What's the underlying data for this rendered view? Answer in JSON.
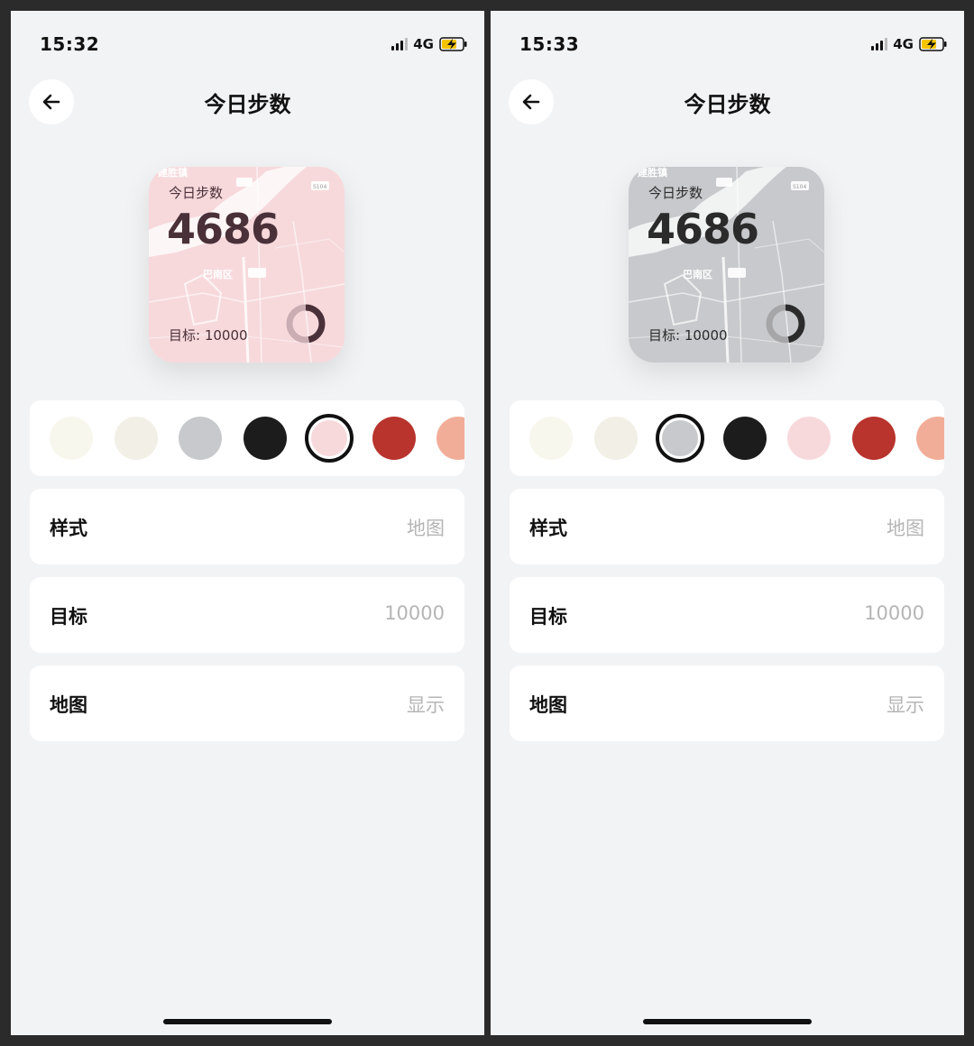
{
  "screens": [
    {
      "status": {
        "time": "15:32",
        "network": "4G"
      },
      "title": "今日步数",
      "widget": {
        "label": "今日步数",
        "steps": "4686",
        "goal_prefix": "目标: ",
        "goal_value": "10000",
        "progress": 0.4686,
        "background": "#f7d9dc",
        "text_color": "#4a3038",
        "ring_track": "#c9adb3",
        "ring_fill": "#4a3038"
      },
      "swatches": [
        {
          "color": "#f8f7ee",
          "selected": false
        },
        {
          "color": "#f2efe6",
          "selected": false
        },
        {
          "color": "#c8c9cc",
          "selected": false
        },
        {
          "color": "#1c1c1c",
          "selected": false
        },
        {
          "color": "#f7d9dc",
          "selected": true
        },
        {
          "color": "#b8342d",
          "selected": false
        },
        {
          "color": "#f2ad98",
          "selected": false
        }
      ],
      "settings": {
        "style": {
          "label": "样式",
          "value": "地图"
        },
        "goal": {
          "label": "目标",
          "value": "10000"
        },
        "map": {
          "label": "地图",
          "value": "显示"
        }
      }
    },
    {
      "status": {
        "time": "15:33",
        "network": "4G"
      },
      "title": "今日步数",
      "widget": {
        "label": "今日步数",
        "steps": "4686",
        "goal_prefix": "目标: ",
        "goal_value": "10000",
        "progress": 0.4686,
        "background": "#c8c9cc",
        "text_color": "#2b2b2b",
        "ring_track": "#a6a6a8",
        "ring_fill": "#2b2b2b"
      },
      "swatches": [
        {
          "color": "#f8f7ee",
          "selected": false
        },
        {
          "color": "#f2efe6",
          "selected": false
        },
        {
          "color": "#c8c9cc",
          "selected": true
        },
        {
          "color": "#1c1c1c",
          "selected": false
        },
        {
          "color": "#f7d9dc",
          "selected": false
        },
        {
          "color": "#b8342d",
          "selected": false
        },
        {
          "color": "#f2ad98",
          "selected": false
        }
      ],
      "settings": {
        "style": {
          "label": "样式",
          "value": "地图"
        },
        "goal": {
          "label": "目标",
          "value": "10000"
        },
        "map": {
          "label": "地图",
          "value": "显示"
        }
      }
    }
  ],
  "map_labels": {
    "town": "建胜镇",
    "district": "巴南区",
    "road": "S104"
  }
}
